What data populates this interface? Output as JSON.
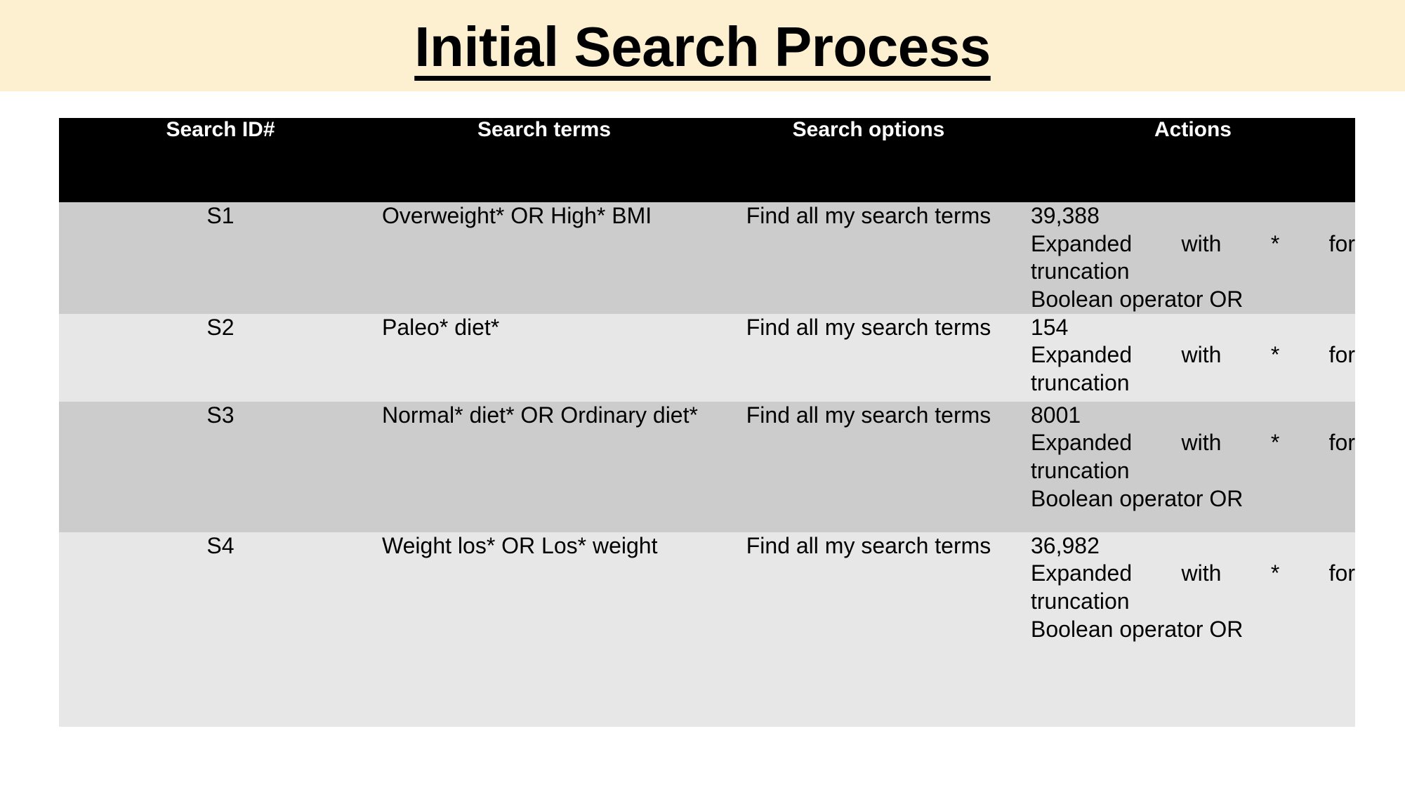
{
  "title": {
    "text": "Initial Search Process",
    "banner_color": "#fcf0d0",
    "text_color": "#000000"
  },
  "table": {
    "header_bg": "#000000",
    "header_fg": "#ffffff",
    "row_shade_dark": "#cccccc",
    "row_shade_light": "#e7e7e7",
    "columns": [
      {
        "key": "search_id",
        "label": "Search ID#"
      },
      {
        "key": "search_terms",
        "label": "Search terms"
      },
      {
        "key": "search_options",
        "label": "Search options"
      },
      {
        "key": "actions",
        "label": "Actions"
      }
    ],
    "rows": [
      {
        "search_id": "S1",
        "search_terms": "Overweight* OR High* BMI",
        "search_options": "Find all my search terms",
        "actions_count": "39,388",
        "actions_line2": "Expanded with * for",
        "actions_line3": "truncation",
        "actions_line4": "Boolean operator OR",
        "shade": "dark"
      },
      {
        "search_id": "S2",
        "search_terms": "Paleo* diet*",
        "search_options": "Find all my search terms",
        "actions_count": "154",
        "actions_line2": "Expanded with * for",
        "actions_line3": "truncation",
        "actions_line4": "",
        "shade": "light"
      },
      {
        "search_id": "S3",
        "search_terms": "Normal* diet* OR Ordinary diet*",
        "search_options": "Find all my search terms",
        "actions_count": "8001",
        "actions_line2": "Expanded with * for",
        "actions_line3": "truncation",
        "actions_line4": "Boolean operator OR",
        "shade": "dark"
      },
      {
        "search_id": "S4",
        "search_terms": "Weight los* OR Los* weight",
        "search_options": "Find all my search terms",
        "actions_count": "36,982",
        "actions_line2": "Expanded with * for",
        "actions_line3": "truncation",
        "actions_line4": "Boolean operator OR",
        "shade": "light"
      }
    ]
  }
}
